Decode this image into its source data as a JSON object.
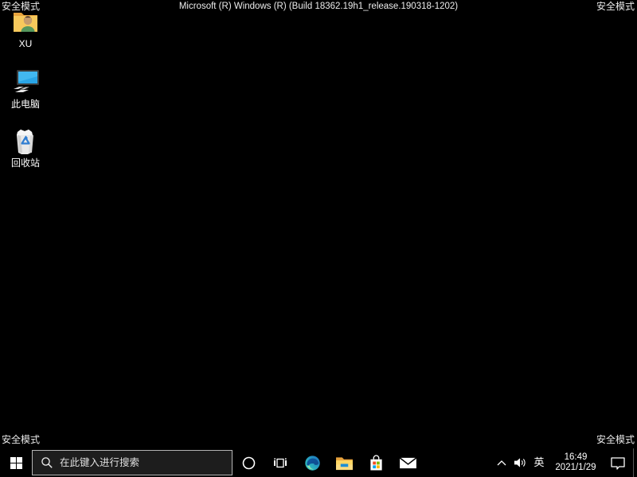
{
  "desktop": {
    "safe_mode_label": "安全模式",
    "build_banner": "Microsoft (R) Windows (R) (Build 18362.19h1_release.190318-1202)",
    "background_color": "#000000",
    "icons": [
      {
        "name": "user-folder-icon",
        "label": "XU"
      },
      {
        "name": "this-pc-icon",
        "label": "此电脑"
      },
      {
        "name": "recycle-bin-icon",
        "label": "回收站"
      }
    ]
  },
  "taskbar": {
    "background_color": "#000000",
    "start_icon": "windows-logo",
    "search": {
      "placeholder": "在此键入进行搜索",
      "icon": "magnifier",
      "box_color": "#1d1d1d",
      "border_color": "#b5b5b5"
    },
    "app_icons": [
      "cortana-circle",
      "task-view",
      "microsoft-edge",
      "file-explorer",
      "microsoft-store",
      "mail"
    ],
    "tray": {
      "chevron_icon": "chevron-up",
      "speaker_icon": "speaker",
      "ime_label": "英",
      "time": "16:49",
      "date": "2021/1/29",
      "action_center_icon": "action-center-bubble"
    }
  },
  "colors": {
    "text": "#ffffff",
    "edge_teal": "#35d4c0",
    "edge_blue": "#0c59a4",
    "folder_dark": "#e8a33d",
    "folder_light": "#ffd764",
    "explorer_blue": "#1e8fd5",
    "store_red": "#f25022",
    "store_green": "#7fba00",
    "store_blue": "#00a4ef",
    "store_yellow": "#ffb900",
    "pc_screen": "#2aa5e6",
    "recycle_blue": "#2f7dd1"
  }
}
